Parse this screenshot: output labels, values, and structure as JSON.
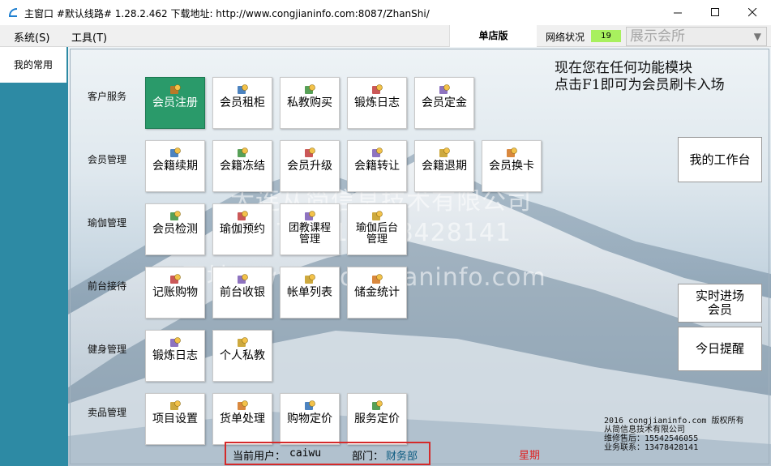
{
  "window": {
    "title": "主窗口 #默认线路# 1.28.2.462 下载地址: http://www.congjianinfo.com:8087/ZhanShi/"
  },
  "menu": {
    "system": "系统(S)",
    "tools": "工具(T)",
    "store_mode": "单店版",
    "network_label": "网络状况",
    "network_value": "19",
    "display_select": "展示会所"
  },
  "sidebar": {
    "tab": "我的常用"
  },
  "notice": {
    "line1": "现在您在任何功能模块",
    "line2": "点击F1即可为会员刷卡入场"
  },
  "watermark": {
    "line1": "大连从简信息技术有限公司",
    "line2": "TEL:13478428141",
    "line3": "网址：www.congjianinfo.com"
  },
  "categories": [
    {
      "label": "客户服务",
      "tiles": [
        {
          "label": "会员注册",
          "icon": "user-group-icon",
          "active": true
        },
        {
          "label": "会员租柜",
          "icon": "locker-icon"
        },
        {
          "label": "私教购买",
          "icon": "box-stack-icon"
        },
        {
          "label": "锻炼日志",
          "icon": "recycle-icon"
        },
        {
          "label": "会员定金",
          "icon": "edit-pen-icon"
        }
      ]
    },
    {
      "label": "会员管理",
      "tiles": [
        {
          "label": "会籍续期",
          "icon": "user-badge-icon"
        },
        {
          "label": "会籍冻结",
          "icon": "snowflake-icon"
        },
        {
          "label": "会员升级",
          "icon": "upgrade-arrow-icon"
        },
        {
          "label": "会籍转让",
          "icon": "transfer-icon"
        },
        {
          "label": "会籍退期",
          "icon": "stop-sign-icon"
        },
        {
          "label": "会员换卡",
          "icon": "card-swap-icon"
        }
      ]
    },
    {
      "label": "瑜伽管理",
      "tiles": [
        {
          "label": "会员检测",
          "icon": "monitor-person-icon"
        },
        {
          "label": "瑜伽预约",
          "icon": "magnifier-person-icon"
        },
        {
          "label": "团教课程管理",
          "line1": "团教课程",
          "line2": "管理",
          "icon": "group-course-icon"
        },
        {
          "label": "瑜伽后台管理",
          "line1": "瑜伽后台",
          "line2": "管理",
          "icon": "tag-icon"
        }
      ]
    },
    {
      "label": "前台接待",
      "tiles": [
        {
          "label": "记账购物",
          "icon": "cart-icon"
        },
        {
          "label": "前台收银",
          "icon": "cash-icon"
        },
        {
          "label": "帐单列表",
          "icon": "bill-person-icon"
        },
        {
          "label": "储金统计",
          "icon": "coin-bag-icon"
        }
      ]
    },
    {
      "label": "健身管理",
      "tiles": [
        {
          "label": "锻炼日志",
          "icon": "notepad-icon"
        },
        {
          "label": "个人私教",
          "icon": "trainer-tag-icon"
        }
      ]
    },
    {
      "label": "卖品管理",
      "tiles": [
        {
          "label": "项目设置",
          "icon": "gear-box-icon"
        },
        {
          "label": "货单处理",
          "icon": "invoice-icon"
        },
        {
          "label": "购物定价",
          "icon": "goods-price-icon"
        },
        {
          "label": "服务定价",
          "icon": "calculator-icon"
        }
      ]
    }
  ],
  "right_buttons": {
    "workbench": "我的工作台",
    "realtime_line1": "实时进场",
    "realtime_line2": "会员",
    "today": "今日提醒"
  },
  "copyright": {
    "line1": "2016 congjianinfo.com 版权所有",
    "line2": "从简信息技术有限公司",
    "line3": "维修售后：15542546055",
    "line4": "业务联系：13478428141"
  },
  "status": {
    "user_label": "当前用户：",
    "user": "caiwu",
    "dept_label": "部门：",
    "dept": "财务部",
    "weekday": "星期"
  },
  "colors": {
    "sidebar": "#2d8aa4",
    "active_tile": "#2a9a6a",
    "network_ok": "#a8f05e",
    "status_border": "#d42a2a"
  }
}
